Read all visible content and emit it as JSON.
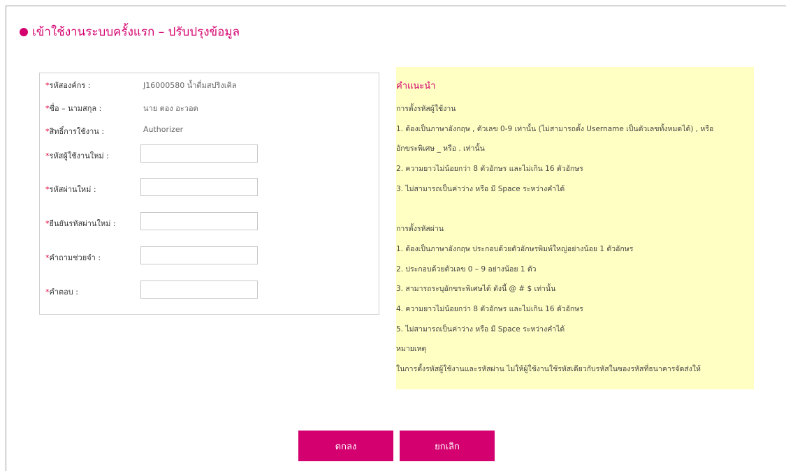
{
  "page_title": "เข้าใช้งานระบบครั้งแรก – ปรับปรุงข้อมูล",
  "colors": {
    "accent": "#d4006f",
    "required": "#e2003a",
    "info_bg": "#ffffc4"
  },
  "form": {
    "org_code": {
      "label": "รหัสองค์กร :",
      "value": "J16000580 น้ำดื่มสปริงเคิล"
    },
    "full_name": {
      "label": "ชื่อ – นามสกุล :",
      "value": "นาย ตอง อะวอต"
    },
    "role": {
      "label": "สิทธิ์การใช้งาน :",
      "value": "Authorizer"
    },
    "new_username": {
      "label": "รหัสผู้ใช้งานใหม่ :",
      "value": "",
      "placeholder": ""
    },
    "new_password": {
      "label": "รหัสผ่านใหม่ :",
      "value": "",
      "placeholder": ""
    },
    "confirm_password": {
      "label": "ยืนยันรหัสผ่านใหม่ :",
      "value": "",
      "placeholder": ""
    },
    "security_question": {
      "label": "คำถามช่วยจำ :",
      "value": "",
      "placeholder": ""
    },
    "answer": {
      "label": "คำตอบ :",
      "value": "",
      "placeholder": ""
    },
    "required_mark": "*"
  },
  "instructions": {
    "title": "คำแนะนำ",
    "lines": [
      "   การตั้งรหัสผู้ใช้งาน",
      "1. ต้องเป็นภาษาอังกฤษ , ตัวเลข 0-9 เท่านั้น (ไม่สามารถตั้ง Username เป็นตัวเลขทั้งหมดได้) , หรือ",
      "อักขระพิเศษ _ หรือ . เท่านั้น",
      "2. ความยาวไม่น้อยกว่า 8 ตัวอักษร และไม่เกิน 16 ตัวอักษร",
      "3. ไม่สามารถเป็นค่าว่าง หรือ มี Space ระหว่างคำได้",
      "   การตั้งรหัสผ่าน",
      "1. ต้องเป็นภาษาอังกฤษ ประกอบด้วยตัวอักษรพิมพ์ใหญ่อย่างน้อย 1 ตัวอักษร",
      "2. ประกอบด้วยตัวเลข 0 – 9 อย่างน้อย 1 ตัว",
      "3. สามารถระบุอักขระพิเศษได้ ดังนี้ @ # $ เท่านั้น",
      "4. ความยาวไม่น้อยกว่า 8 ตัวอักษร และไม่เกิน 16 ตัวอักษร",
      "5. ไม่สามารถเป็นค่าว่าง หรือ มี Space ระหว่างคำได้",
      "หมายเหตุ",
      "ในการตั้งรหัสผู้ใช้งานและรหัสผ่าน ไม่ให้ผู้ใช้งานใช้รหัสเดียวกับรหัสในซองรหัสที่ธนาคารจัดส่งให้"
    ]
  },
  "buttons": {
    "ok": "ตกลง",
    "cancel": "ยกเลิก"
  }
}
